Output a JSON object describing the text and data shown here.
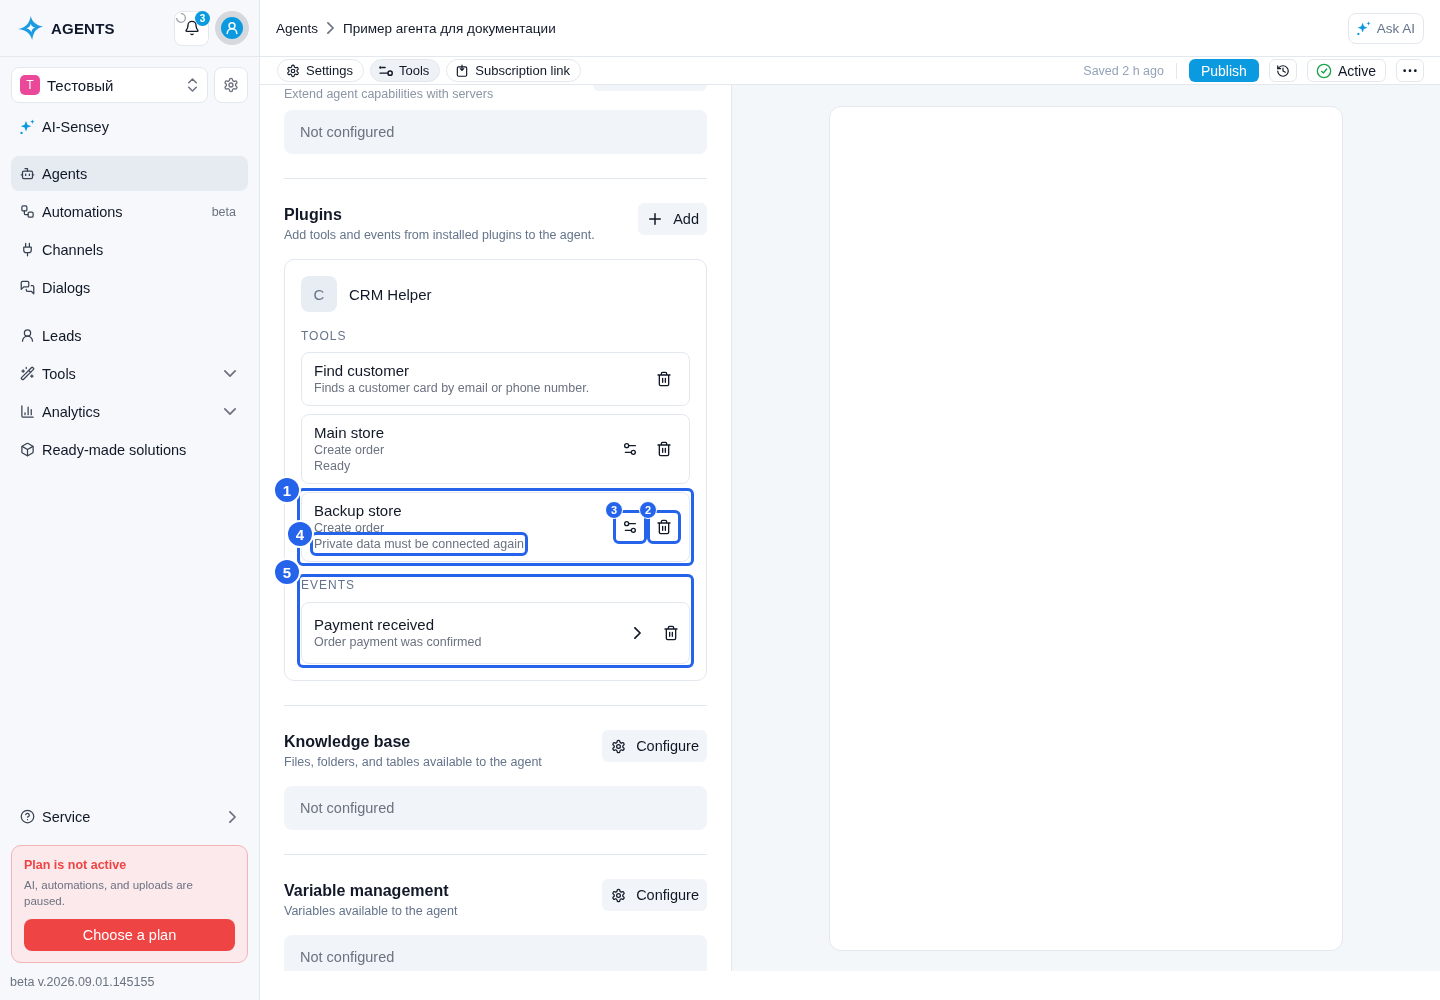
{
  "sidebar": {
    "logo": "AGENTS",
    "notifications": {
      "count": "3",
      "loading": true
    },
    "workspace": {
      "initial": "T",
      "name": "Тестовый"
    },
    "assistant": "AI-Sensey",
    "nav_groups": [
      {
        "items": [
          {
            "label": "Agents",
            "kind": "link",
            "selected": true
          },
          {
            "label": "Automations",
            "kind": "link",
            "selected": false,
            "tag": "beta"
          },
          {
            "label": "Channels",
            "kind": "link",
            "selected": false
          },
          {
            "label": "Dialogs",
            "kind": "link",
            "selected": false
          }
        ]
      },
      {
        "items": [
          {
            "label": "Leads",
            "kind": "link",
            "selected": false
          },
          {
            "label": "Tools",
            "kind": "group",
            "selected": false,
            "expanded": false
          },
          {
            "label": "Analytics",
            "kind": "group",
            "selected": false,
            "expanded": false
          },
          {
            "label": "Ready-made solutions",
            "kind": "link",
            "selected": false
          }
        ]
      }
    ],
    "service": "Service",
    "plan_notice": {
      "title": "Plan is not active",
      "text": "AI, automations, and uploads are paused.",
      "button": "Choose a plan"
    },
    "version": "beta v.2026.09.01.145155"
  },
  "header": {
    "breadcrumbs": [
      "Agents",
      "Пример агента для документации"
    ],
    "ask_ai": "Ask AI"
  },
  "toolbar": {
    "tabs": [
      {
        "label": "Settings",
        "selected": false
      },
      {
        "label": "Tools",
        "selected": true
      },
      {
        "label": "Subscription link",
        "selected": false
      }
    ],
    "saved": "Saved 2 h ago",
    "publish": "Publish",
    "status": {
      "label": "Active",
      "on": true
    }
  },
  "editor": {
    "servers": {
      "subtitle": "Extend agent capabilities with servers",
      "empty": "Not configured"
    },
    "plugins": {
      "title": "Plugins",
      "subtitle": "Add tools and events from installed plugins to the agent.",
      "add": "Add",
      "plugin": {
        "initial": "C",
        "name": "CRM Helper",
        "tools": {
          "label": "TOOLS",
          "items": [
            {
              "name": "Find customer",
              "details": [
                {
                  "text": "Finds a customer card by email or phone number."
                }
              ],
              "actions": [
                {
                  "kind": "delete"
                }
              ]
            },
            {
              "name": "Main store",
              "details": [
                {
                  "text": "Create order"
                },
                {
                  "text": "Ready"
                }
              ],
              "actions": [
                {
                  "kind": "configure"
                },
                {
                  "kind": "delete"
                }
              ]
            },
            {
              "name": "Backup store",
              "annotation": "1",
              "details": [
                {
                  "text": "Create order"
                },
                {
                  "text": "Private data must be connected again",
                  "annotation": "4"
                }
              ],
              "actions": [
                {
                  "kind": "configure",
                  "annotation": "3"
                },
                {
                  "kind": "delete",
                  "annotation": "2"
                }
              ]
            }
          ]
        },
        "events": {
          "label": "EVENTS",
          "annotation": "5",
          "items": [
            {
              "name": "Payment received",
              "details": [
                {
                  "text": "Order payment was confirmed"
                }
              ],
              "actions": [
                {
                  "kind": "open"
                },
                {
                  "kind": "delete"
                }
              ]
            }
          ]
        }
      }
    },
    "knowledge_base": {
      "title": "Knowledge base",
      "subtitle": "Files, folders, and tables available to the agent",
      "button": "Configure",
      "empty": "Not configured"
    },
    "variables": {
      "title": "Variable management",
      "subtitle": "Variables available to the agent",
      "button": "Configure",
      "empty": "Not configured"
    }
  }
}
